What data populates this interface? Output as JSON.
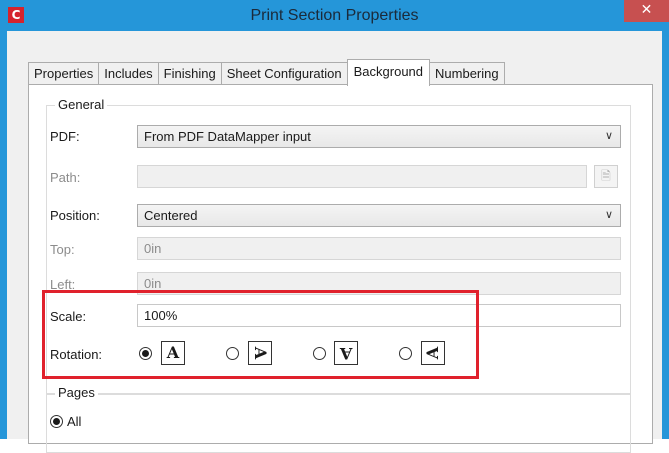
{
  "window": {
    "title": "Print Section Properties",
    "app_icon": "C",
    "close_glyph": "✕"
  },
  "tabs": [
    "Properties",
    "Includes",
    "Finishing",
    "Sheet Configuration",
    "Background",
    "Numbering"
  ],
  "active_tab": "Background",
  "general": {
    "legend": "General",
    "pdf_label": "PDF:",
    "pdf_value": "From PDF DataMapper input",
    "path_label": "Path:",
    "path_value": "",
    "position_label": "Position:",
    "position_value": "Centered",
    "top_label": "Top:",
    "top_value": "0in",
    "left_label": "Left:",
    "left_value": "0in",
    "scale_label": "Scale:",
    "scale_value": "100%",
    "rotation_label": "Rotation:",
    "rotation_options": [
      "0",
      "90",
      "180",
      "270"
    ],
    "rotation_selected": "0",
    "rotation_glyph": "A"
  },
  "pages": {
    "legend": "Pages",
    "all_label": "All"
  },
  "colors": {
    "title_bar": "#2596d9",
    "close_button": "#c75050",
    "highlight": "#e0212c"
  }
}
